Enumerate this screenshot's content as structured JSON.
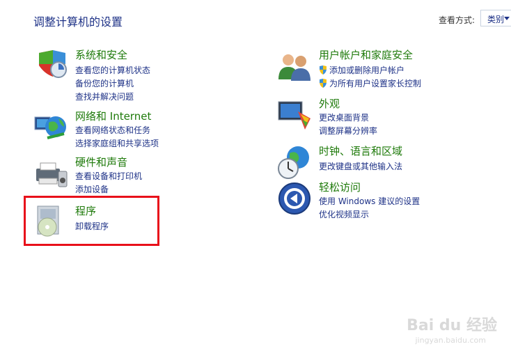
{
  "header": {
    "title": "调整计算机的设置",
    "view_by_label": "查看方式:",
    "view_by_value": "类别"
  },
  "left": [
    {
      "name": "system-security",
      "heading": "系统和安全",
      "links": [
        "查看您的计算机状态",
        "备份您的计算机",
        "查找并解决问题"
      ]
    },
    {
      "name": "network-internet",
      "heading": "网络和 Internet",
      "links": [
        "查看网络状态和任务",
        "选择家庭组和共享选项"
      ]
    },
    {
      "name": "hardware-sound",
      "heading": "硬件和声音",
      "links": [
        "查看设备和打印机",
        "添加设备"
      ]
    },
    {
      "name": "programs",
      "heading": "程序",
      "links": [
        "卸载程序"
      ]
    }
  ],
  "right": [
    {
      "name": "user-accounts",
      "heading": "用户帐户和家庭安全",
      "links": [
        "添加或删除用户帐户",
        "为所有用户设置家长控制"
      ]
    },
    {
      "name": "appearance",
      "heading": "外观",
      "links": [
        "更改桌面背景",
        "调整屏幕分辨率"
      ]
    },
    {
      "name": "clock-region",
      "heading": "时钟、语言和区域",
      "links": [
        "更改键盘或其他输入法"
      ]
    },
    {
      "name": "ease-of-access",
      "heading": "轻松访问",
      "links": [
        "使用 Windows 建议的设置",
        "优化视频显示"
      ]
    }
  ],
  "watermark": {
    "brand": "Bai du 经验",
    "url": "jingyan.baidu.com"
  }
}
